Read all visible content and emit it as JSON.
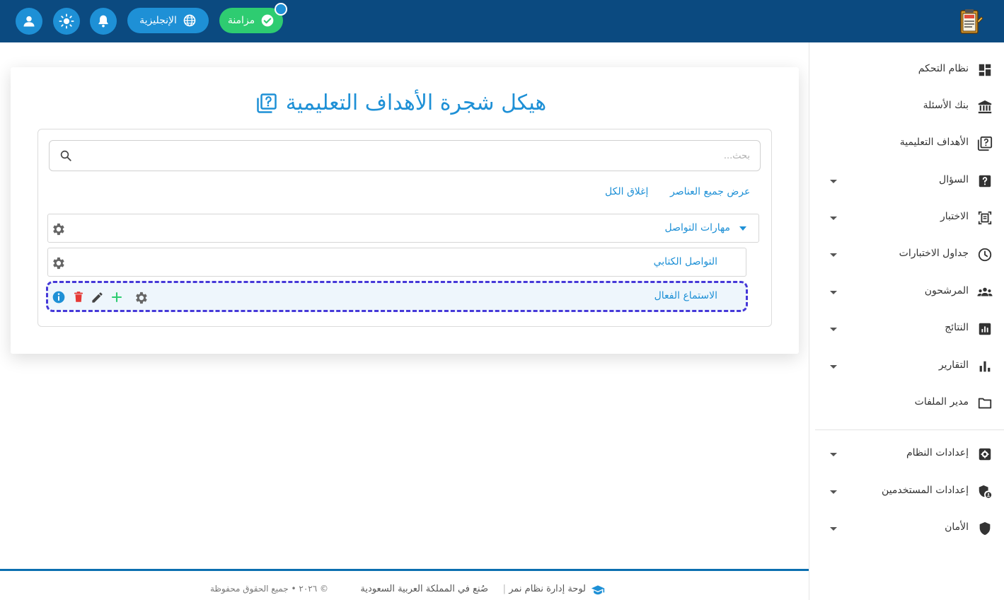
{
  "topbar": {
    "sync_label": "مزامنة",
    "language_label": "الإنجليزية",
    "icons": [
      "user-icon",
      "sun-icon",
      "bell-icon",
      "globe-icon",
      "check-icon"
    ]
  },
  "page": {
    "title": "هيكل شجرة الأهداف التعليمية",
    "search_placeholder": "بحث...",
    "expand_all": "عرض جميع العناصر",
    "collapse_all": "إغلاق الكل"
  },
  "tree": {
    "root": {
      "label": "مهارات التواصل"
    },
    "children": [
      {
        "label": "التواصل الكتابي"
      },
      {
        "label": "الاستماع الفعال"
      }
    ]
  },
  "sidebar": {
    "items": [
      {
        "label": "نظام التحكم",
        "icon": "dashboard-icon",
        "has_caret": false
      },
      {
        "label": "بنك الأسئلة",
        "icon": "bank-icon",
        "has_caret": false
      },
      {
        "label": "الأهداف التعليمية",
        "icon": "objectives-icon",
        "has_caret": false
      },
      {
        "label": "السؤال",
        "icon": "question-icon",
        "has_caret": true
      },
      {
        "label": "الاختبار",
        "icon": "exam-icon",
        "has_caret": true
      },
      {
        "label": "جداول الاختبارات",
        "icon": "clock-icon",
        "has_caret": true
      },
      {
        "label": "المرشحون",
        "icon": "candidates-icon",
        "has_caret": true
      },
      {
        "label": "النتائج",
        "icon": "results-icon",
        "has_caret": true
      },
      {
        "label": "التقارير",
        "icon": "reports-icon",
        "has_caret": true
      },
      {
        "label": "مدير الملفات",
        "icon": "folder-icon",
        "has_caret": false
      },
      {
        "label": "إعدادات النظام",
        "icon": "system-settings-icon",
        "has_caret": true
      },
      {
        "label": "إعدادات المستخدمين",
        "icon": "user-settings-icon",
        "has_caret": true
      },
      {
        "label": "الأمان",
        "icon": "shield-icon",
        "has_caret": true
      }
    ]
  },
  "footer": {
    "brand": "لوحة إدارة نظام نمر",
    "made_in": "صُنع في المملكة العربية السعودية",
    "copyright": "© ٢٠٢٦ • جميع الحقوق محفوظة"
  },
  "colors": {
    "topbar": "#0b4a80",
    "accent": "#1e90d6",
    "sync": "#2ecc71",
    "selected_border": "#4638d8",
    "delete": "#e53935",
    "add": "#2ecc71"
  }
}
